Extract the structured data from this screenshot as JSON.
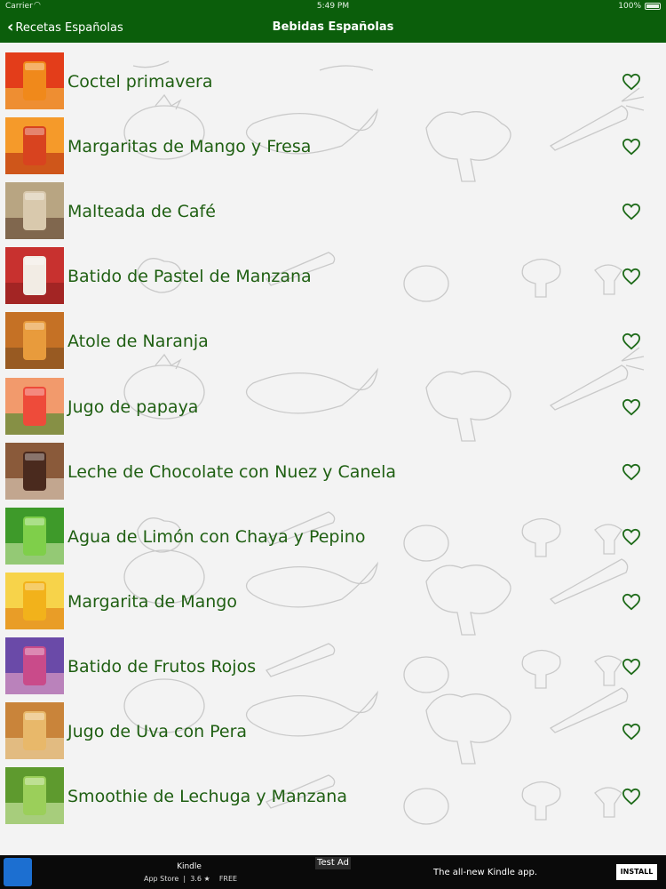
{
  "status_bar": {
    "carrier": "Carrier",
    "time": "5:49 PM",
    "battery": "100%"
  },
  "nav": {
    "back_label": "Recetas Españolas",
    "title": "Bebidas Españolas"
  },
  "recipes": [
    {
      "title": "Coctel primavera"
    },
    {
      "title": "Margaritas de Mango y Fresa"
    },
    {
      "title": "Malteada de Café"
    },
    {
      "title": "Batido de Pastel de Manzana"
    },
    {
      "title": "Atole de Naranja"
    },
    {
      "title": "Jugo de papaya"
    },
    {
      "title": "Leche de Chocolate con Nuez y Canela"
    },
    {
      "title": "Agua de Limón con Chaya y Pepino"
    },
    {
      "title": "Margarita de Mango"
    },
    {
      "title": "Batido de Frutos Rojos"
    },
    {
      "title": "Jugo de Uva con Pera"
    },
    {
      "title": "Smoothie de Lechuga y Manzana"
    }
  ],
  "ad": {
    "label": "Test Ad",
    "app_name": "Kindle",
    "store": "App Store",
    "rating": "3.6 ★",
    "price": "FREE",
    "tagline": "The all-new Kindle app.",
    "install_label": "INSTALL"
  },
  "colors": {
    "nav_bar": "#0b5e0b",
    "title_text": "#1f5f12",
    "heart": "#1f6b1a",
    "background": "#f3f3f3"
  }
}
